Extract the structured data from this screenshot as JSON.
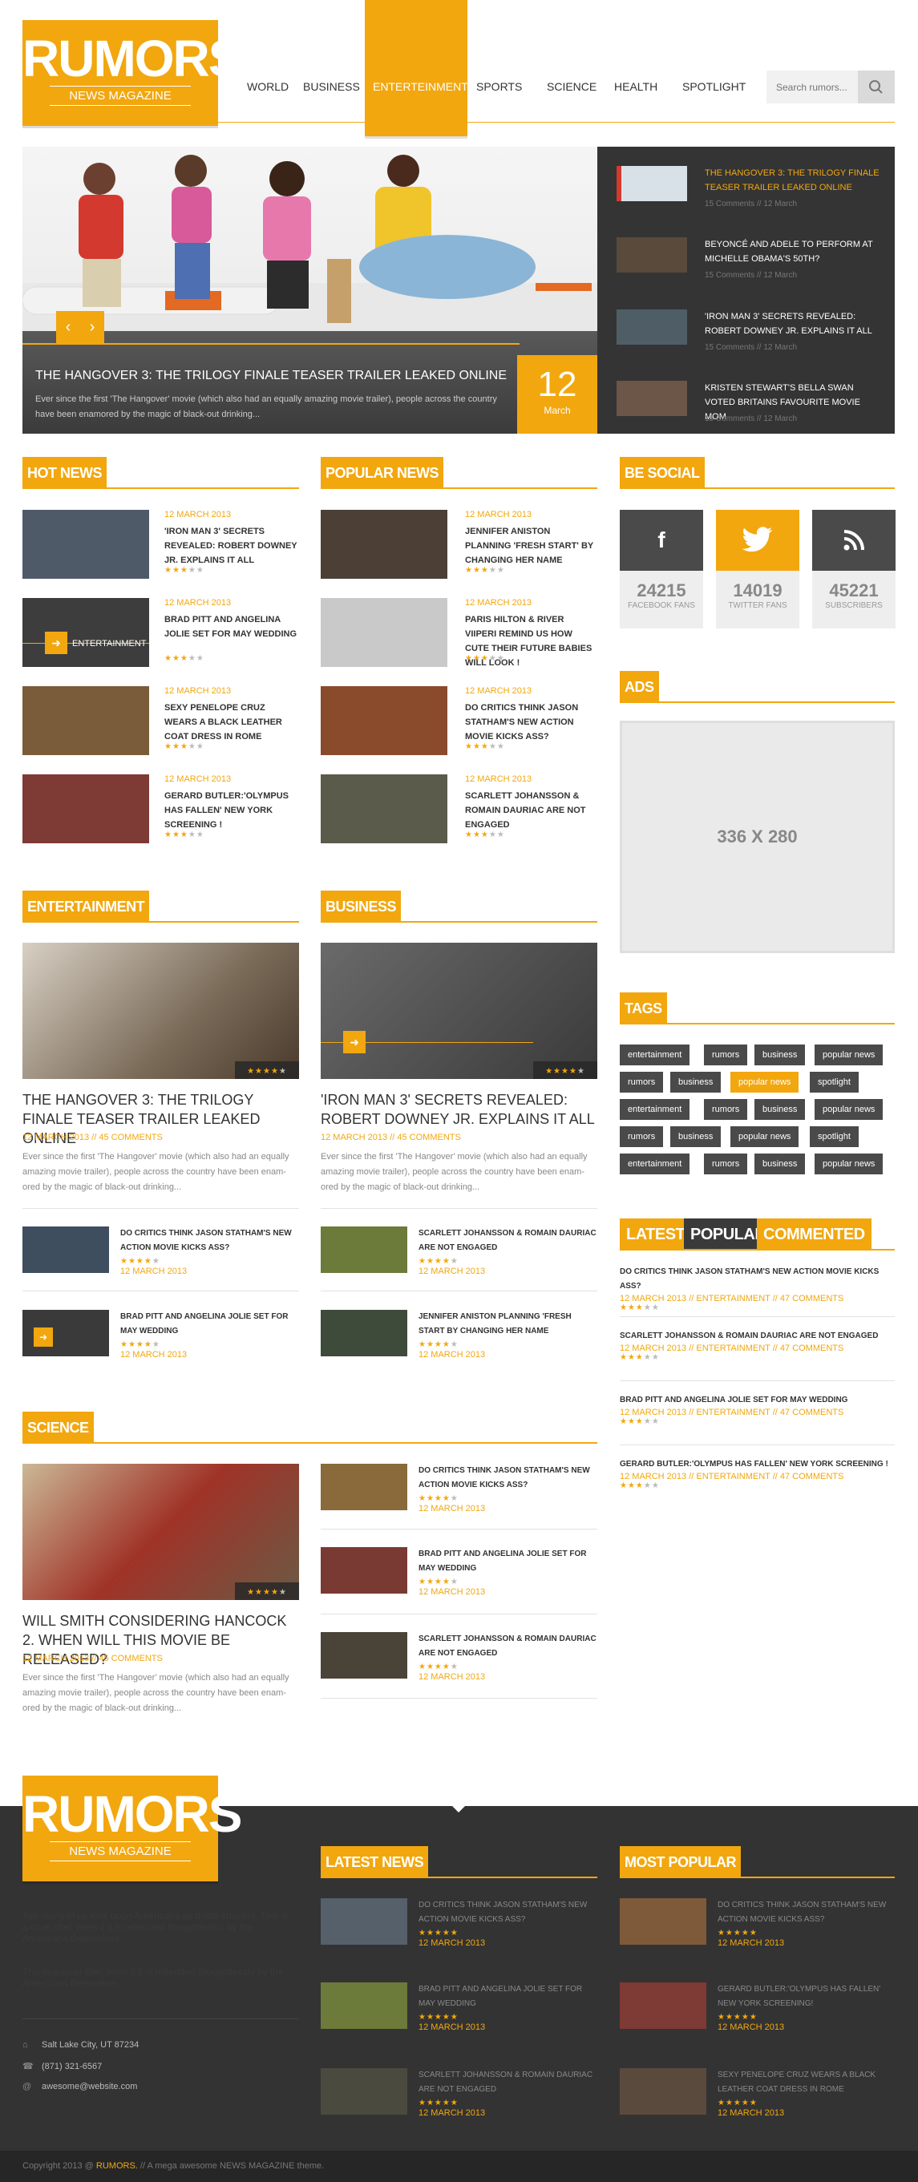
{
  "brand": {
    "name": "RUMORS",
    "tagline": "NEWS MAGAZINE"
  },
  "nav": {
    "items": [
      "WORLD",
      "BUSINESS",
      "ENTERTEINMENT",
      "SPORTS",
      "SCIENCE",
      "HEALTH",
      "SPOTLIGHT"
    ],
    "active": "ENTERTEINMENT"
  },
  "search": {
    "placeholder": "Search rumors..."
  },
  "hero": {
    "title": "THE HANGOVER 3: THE TRILOGY FINALE TEASER TRAILER LEAKED ONLINE",
    "excerpt": "Ever since the first 'The Hangover' movie (which also had an equally amazing movie trailer), people across the country have been enamored by the magic of black-out drinking...",
    "day": "12",
    "month": "March",
    "prev_label": "‹",
    "next_label": "›"
  },
  "slider_list": [
    {
      "title": "THE HANGOVER 3: THE TRILOGY FINALE TEASER TRAILER LEAKED ONLINE",
      "meta": "15 Comments // 12 March"
    },
    {
      "title": "BEYONCÉ AND ADELE TO PERFORM AT MICHELLE OBAMA'S 50TH?",
      "meta": "15 Comments // 12 March"
    },
    {
      "title": "'IRON MAN 3' SECRETS REVEALED: ROBERT DOWNEY JR. EXPLAINS IT ALL",
      "meta": "15 Comments // 12 March"
    },
    {
      "title": "KRISTEN STEWART'S BELLA SWAN VOTED BRITAINS FAVOURITE MOVIE MOM",
      "meta": "15 Comments // 12 March"
    }
  ],
  "hot_news": {
    "heading": "HOT NEWS",
    "items": [
      {
        "date": "12 MARCH 2013",
        "title": "'IRON MAN 3' SECRETS REVEALED: ROBERT DOWNEY JR. EXPLAINS IT ALL",
        "overlay": ""
      },
      {
        "date": "12 MARCH 2013",
        "title": "BRAD PITT AND ANGELINA JOLIE SET FOR MAY WEDDING",
        "overlay": "ENTERTAINMENT"
      },
      {
        "date": "12 MARCH 2013",
        "title": "SEXY PENELOPE CRUZ WEARS A BLACK LEATHER COAT DRESS IN ROME",
        "overlay": ""
      },
      {
        "date": "12 MARCH 2013",
        "title": "GERARD BUTLER:'OLYMPUS HAS FALLEN' NEW YORK SCREENING !",
        "overlay": ""
      }
    ]
  },
  "popular_news": {
    "heading": "POPULAR NEWS",
    "items": [
      {
        "date": "12 MARCH 2013",
        "title": "JENNIFER ANISTON PLANNING 'FRESH START' BY CHANGING HER NAME"
      },
      {
        "date": "12 MARCH 2013",
        "title": "PARIS HILTON & RIVER VIIPERI REMIND US HOW CUTE THEIR FUTURE BABIES WILL LOOK !"
      },
      {
        "date": "12 MARCH 2013",
        "title": "DO CRITICS THINK JASON STATHAM'S NEW ACTION MOVIE KICKS ASS?"
      },
      {
        "date": "12 MARCH 2013",
        "title": "SCARLETT JOHANSSON & ROMAIN DAURIAC ARE NOT ENGAGED"
      }
    ]
  },
  "social": {
    "heading": "BE SOCIAL",
    "items": [
      {
        "icon": "f",
        "count": "24215",
        "label": "FACEBOOK FANS",
        "color": "#4a4a4a"
      },
      {
        "icon": "t",
        "count": "14019",
        "label": "TWITTER FANS",
        "color": "#f2a70f"
      },
      {
        "icon": "rss",
        "count": "45221",
        "label": "SUBSCRIBERS",
        "color": "#4a4a4a"
      }
    ]
  },
  "ads": {
    "heading": "ADS",
    "size": "336 X 280"
  },
  "tags": {
    "heading": "TAGS",
    "rows": [
      [
        "entertainment",
        "rumors",
        "business",
        "popular news"
      ],
      [
        "rumors",
        "business",
        "popular news",
        "spotlight"
      ],
      [
        "entertainment",
        "rumors",
        "business",
        "popular news"
      ],
      [
        "rumors",
        "business",
        "popular news",
        "spotlight"
      ],
      [
        "entertainment",
        "rumors",
        "business",
        "popular news"
      ]
    ],
    "active": "popular news"
  },
  "entertainment": {
    "heading": "ENTERTAINMENT",
    "title": "THE HANGOVER 3: THE TRILOGY FINALE TEASER TRAILER LEAKED ONLINE",
    "meta": "12 MARCH 2013 // 45 COMMENTS",
    "excerpt": "Ever since the first 'The Hangover' movie (which also had an equally amazing movie trailer), people across the country have been enam-ored by the magic of black-out drinking...",
    "items": [
      {
        "title": "DO CRITICS THINK JASON STATHAM'S NEW ACTION MOVIE KICKS ASS?",
        "date": "12 MARCH 2013"
      },
      {
        "title": "BRAD PITT AND ANGELINA JOLIE SET FOR MAY WEDDING",
        "date": "12 MARCH 2013"
      }
    ]
  },
  "business": {
    "heading": "BUSINESS",
    "title": "'IRON MAN 3' SECRETS REVEALED: ROBERT DOWNEY JR. EXPLAINS IT ALL",
    "meta": "12 MARCH 2013 // 45 COMMENTS",
    "excerpt": "Ever since the first 'The Hangover' movie (which also had an equally amazing movie trailer), people across the country have been enam-ored by the magic of black-out drinking...",
    "items": [
      {
        "title": "SCARLETT JOHANSSON & ROMAIN DAURIAC ARE NOT ENGAGED",
        "date": "12 MARCH 2013"
      },
      {
        "title": "JENNIFER ANISTON PLANNING 'FRESH START BY CHANGING HER NAME",
        "date": "12 MARCH 2013"
      }
    ]
  },
  "science": {
    "heading": "SCIENCE",
    "title": "WILL SMITH CONSIDERING HANCOCK 2. WHEN WILL THIS MOVIE BE RELEASED?",
    "meta": "12 MARCH 2013 // 45 COMMENTS",
    "excerpt": "Ever since the first 'The Hangover' movie (which also had an equally amazing movie trailer), people across the country have been enam-ored by the magic of black-out drinking...",
    "items": [
      {
        "title": "DO CRITICS THINK JASON STATHAM'S NEW ACTION MOVIE KICKS ASS?",
        "date": "12 MARCH 2013"
      },
      {
        "title": "BRAD PITT AND ANGELINA JOLIE SET FOR MAY WEDDING",
        "date": "12 MARCH 2013"
      },
      {
        "title": "SCARLETT JOHANSSON & ROMAIN DAURIAC ARE NOT ENGAGED",
        "date": "12 MARCH 2013"
      }
    ]
  },
  "tabs": {
    "labels": [
      "LATEST",
      "POPULAR",
      "COMMENTED"
    ],
    "items": [
      {
        "title": "DO CRITICS THINK JASON STATHAM'S NEW ACTION MOVIE KICKS ASS?",
        "meta": "12 MARCH 2013 // ENTERTAINMENT // 47 COMMENTS"
      },
      {
        "title": "SCARLETT JOHANSSON & ROMAIN DAURIAC ARE NOT ENGAGED",
        "meta": "12 MARCH 2013 // ENTERTAINMENT // 47 COMMENTS"
      },
      {
        "title": "BRAD PITT AND ANGELINA JOLIE SET FOR MAY WEDDING",
        "meta": "12 MARCH 2013 // ENTERTAINMENT // 47 COMMENTS"
      },
      {
        "title": "GERARD BUTLER:'OLYMPUS HAS FALLEN' NEW YORK SCREENING !",
        "meta": "12 MARCH 2013 // ENTERTAINMENT // 47 COMMENTS"
      }
    ]
  },
  "footer": {
    "about1": "Too many of us look upon Americans as dollar chasers. This is a cruel libel, even if it is reiterated thoughtlessly by the Americans themselves.",
    "about2": "This is a cruel libel, even if it is reiterated thoughtlessly by the Americans themselves.",
    "address": "Salt Lake City, UT 87234",
    "phone": "(871) 321-6567",
    "email": "awesome@website.com",
    "latest": {
      "heading": "LATEST NEWS",
      "items": [
        {
          "title": "DO CRITICS THINK JASON STATHAM'S NEW ACTION MOVIE KICKS ASS?",
          "date": "12 MARCH 2013"
        },
        {
          "title": "BRAD PITT AND ANGELINA JOLIE SET FOR MAY WEDDING",
          "date": "12 MARCH 2013"
        },
        {
          "title": "SCARLETT JOHANSSON & ROMAIN DAURIAC ARE NOT ENGAGED",
          "date": "12 MARCH 2013"
        }
      ]
    },
    "popular": {
      "heading": "MOST POPULAR",
      "items": [
        {
          "title": "DO CRITICS THINK JASON STATHAM'S NEW ACTION MOVIE KICKS ASS?",
          "date": "12 MARCH 2013"
        },
        {
          "title": "GERARD BUTLER:'OLYMPUS HAS FALLEN' NEW YORK SCREENING!",
          "date": "12 MARCH 2013"
        },
        {
          "title": "SEXY PENELOPE CRUZ WEARS A BLACK LEATHER COAT DRESS IN ROME",
          "date": "12 MARCH 2013"
        }
      ]
    },
    "copyright_pre": "Copyright 2013 @",
    "copyright_brand": "RUMORS.",
    "copyright_post": "// A mega awesome NEWS MAGAZINE theme."
  }
}
